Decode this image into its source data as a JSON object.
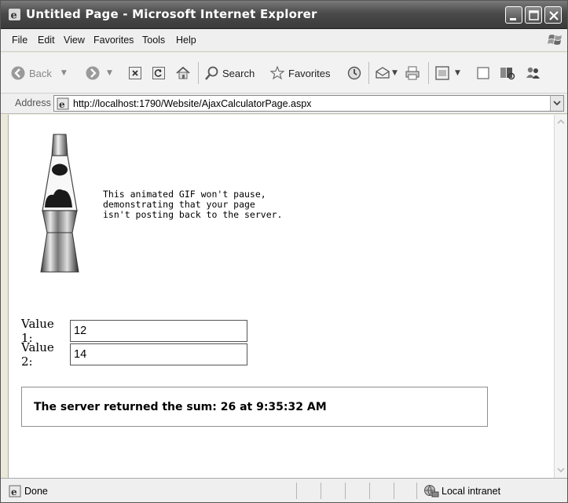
{
  "window": {
    "title": "Untitled Page - Microsoft Internet Explorer"
  },
  "menu": {
    "items": [
      "File",
      "Edit",
      "View",
      "Favorites",
      "Tools",
      "Help"
    ]
  },
  "toolbar": {
    "back_label": "Back",
    "search_label": "Search",
    "favorites_label": "Favorites"
  },
  "address": {
    "label": "Address",
    "url": "http://localhost:1790/Website/AjaxCalculatorPage.aspx"
  },
  "page": {
    "gif_caption": "This animated GIF won't pause,\ndemonstrating that your page\nisn't posting back to the server.",
    "value1_label": "Value 1:",
    "value1": "12",
    "value2_label": "Value 2:",
    "value2": "14",
    "result": "The server returned the sum: 26 at 9:35:32 AM"
  },
  "status": {
    "text": "Done",
    "zone": "Local intranet"
  },
  "icons": [
    "ie-icon",
    "minimize-icon",
    "maximize-icon",
    "close-icon",
    "windows-flag-icon",
    "back-icon",
    "forward-icon",
    "stop-icon",
    "refresh-icon",
    "home-icon",
    "search-icon",
    "favorites-star-icon",
    "history-icon",
    "mail-icon",
    "print-icon",
    "edit-icon",
    "discuss-icon",
    "research-icon",
    "messenger-icon",
    "page-icon",
    "intranet-icon"
  ]
}
